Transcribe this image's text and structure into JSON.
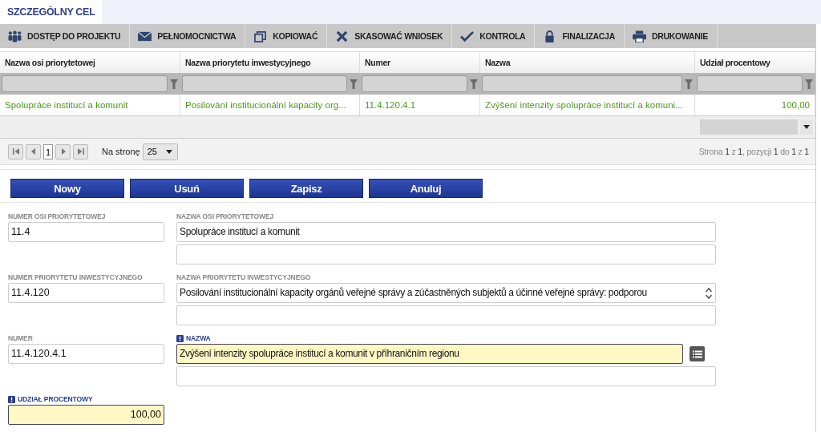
{
  "tab": {
    "label": "SZCZEGÓLNY CEL",
    "selected": true
  },
  "toolbar": [
    {
      "kind": "people",
      "label": "DOSTĘP DO PROJEKTU"
    },
    {
      "kind": "envelope",
      "label": "PEŁNOMOCNICTWA"
    },
    {
      "kind": "copy",
      "label": "KOPIOWAĆ"
    },
    {
      "kind": "cross",
      "label": "SKASOWAĆ WNIOSEK"
    },
    {
      "kind": "check",
      "label": "KONTROLA"
    },
    {
      "kind": "lock",
      "label": "FINALIZACJA"
    },
    {
      "kind": "printer",
      "label": "DRUKOWANIE"
    }
  ],
  "table": {
    "columns": [
      {
        "label": "Nazwa osi priorytetowej"
      },
      {
        "label": "Nazwa priorytetu inwestycyjnego"
      },
      {
        "label": "Numer"
      },
      {
        "label": "Nazwa"
      },
      {
        "label": "Udział procentowy"
      }
    ],
    "rows": [
      {
        "cells": [
          "Spolupráce institucí a komunit",
          "Posilování institucionální kapacity org...",
          "11.4.120.4.1",
          "Zvýšení intenzity spolupráce institucí a komuni...",
          "100,00"
        ]
      }
    ]
  },
  "pager": {
    "page": "1",
    "per_page_label": "Na stronę",
    "per_page": "25",
    "summary": "Strona **1** z **1**, pozycji **1** do **1** z **1**"
  },
  "buttons": [
    "Nowy",
    "Usuń",
    "Zapisz",
    "Anuluj"
  ],
  "form": [
    {
      "left": {
        "label": "NUMER OSI PRIORYTETOWEJ",
        "value": "11.4",
        "required": false
      },
      "right": {
        "label": "NAZWA OSI PRIORYTETOWEJ",
        "value": "Spolupráce institucí a komunit",
        "required": false,
        "kind": "text"
      }
    },
    {
      "left": {
        "label": "NUMER PRIORYTETU INWESTYCYJNEGO",
        "value": "11.4.120",
        "required": false
      },
      "right": {
        "label": "NAZWA PRIORYTETU INWESTYCYJNEGO",
        "value": "Posilování institucionální kapacity orgánů veřejné správy a zúčastněných subjektů a účinné veřejné správy: podporou",
        "required": false,
        "kind": "scroll"
      }
    },
    {
      "left": {
        "label": "NUMER",
        "value": "11.4.120.4.1",
        "required": false
      },
      "right": {
        "label": "NAZWA",
        "value": "Zvýšení intenzity spolupráce institucí a komunit v příhraničním regionu",
        "required": true,
        "kind": "list"
      }
    },
    {
      "left": {
        "label": "UDZIAŁ PROCENTOWY",
        "value": "100,00",
        "required": true
      }
    }
  ]
}
